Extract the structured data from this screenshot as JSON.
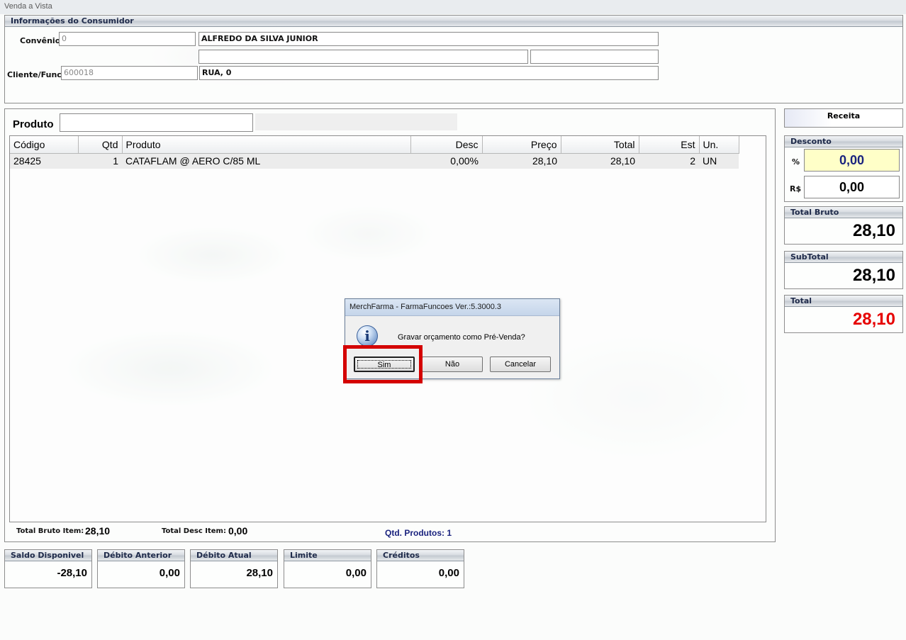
{
  "window": {
    "title": "Venda a Vista"
  },
  "consumer": {
    "header": "Informações do Consumidor",
    "convenio_label": "Convênio",
    "convenio_code": "0",
    "convenio_name": "ALFREDO DA SILVA JUNIOR",
    "extra_field_1": "",
    "extra_field_2": "",
    "cliente_label": "Cliente/Func",
    "cliente_code": "600018",
    "address": "RUA, 0"
  },
  "product": {
    "label": "Produto",
    "input_value": "",
    "columns": [
      "Código",
      "Qtd",
      "Produto",
      "Desc",
      "Preço",
      "Total",
      "Est",
      "Un."
    ],
    "rows": [
      {
        "codigo": "28425",
        "qtd": "1",
        "produto": "CATAFLAM @ AERO C/85 ML",
        "desc": "0,00%",
        "preco": "28,10",
        "total": "28,10",
        "est": "2",
        "un": "UN"
      }
    ]
  },
  "footer": {
    "total_bruto_item_label": "Total Bruto Item:",
    "total_bruto_item_value": "28,10",
    "total_desc_item_label": "Total Desc Item:",
    "total_desc_item_value": "0,00",
    "qtd_produtos": "Qtd. Produtos: 1"
  },
  "right_panel": {
    "receita_label": "Receita",
    "desconto_header": "Desconto",
    "percent_label": "%",
    "percent_value": "0,00",
    "rs_label": "R$",
    "rs_value": "0,00",
    "total_bruto_header": "Total Bruto",
    "total_bruto_value": "28,10",
    "subtotal_header": "SubTotal",
    "subtotal_value": "28,10",
    "total_header": "Total",
    "total_value": "28,10"
  },
  "bottom_boxes": [
    {
      "header": "Saldo Disponivel",
      "value": "-28,10"
    },
    {
      "header": "Débito Anterior",
      "value": "0,00"
    },
    {
      "header": "Débito Atual",
      "value": "28,10"
    },
    {
      "header": "Limite",
      "value": "0,00"
    },
    {
      "header": "Créditos",
      "value": "0,00"
    }
  ],
  "dialog": {
    "title": "MerchFarma - FarmaFuncoes  Ver.:5.3000.3",
    "message": "Gravar orçamento como Pré-Venda?",
    "icon": "info-icon",
    "buttons": {
      "yes": "Sim",
      "no": "Não",
      "cancel": "Cancelar"
    }
  },
  "colors": {
    "total_red": "#e60000",
    "percent_blue": "#1a237e",
    "percent_bg": "#ffffc8",
    "highlight_red": "#d40000"
  }
}
